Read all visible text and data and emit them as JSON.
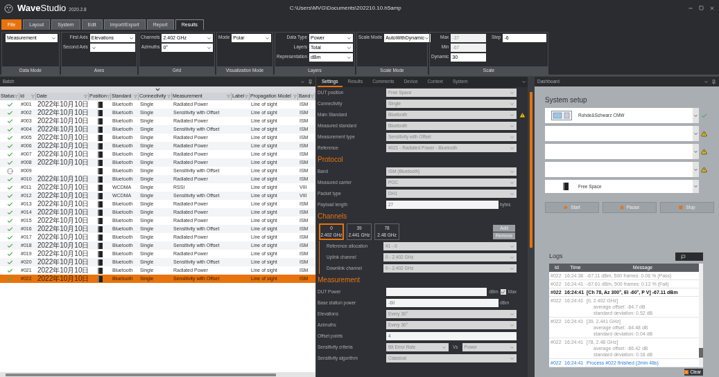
{
  "app": {
    "name_bold": "Wave",
    "name_rest": "Studio",
    "version": "2020.2.8",
    "path": "C:\\Users\\MVG\\Documents\\202210.10.h5amp"
  },
  "menu_tabs": [
    {
      "label": "File",
      "kind": "file",
      "selected": false
    },
    {
      "label": "Layout",
      "kind": "tab",
      "selected": false
    },
    {
      "label": "System",
      "kind": "tab",
      "selected": false
    },
    {
      "label": "Edit",
      "kind": "tab",
      "selected": false
    },
    {
      "label": "Import/Export",
      "kind": "tab",
      "selected": false
    },
    {
      "label": "Report",
      "kind": "tab",
      "selected": false
    },
    {
      "label": "Results",
      "kind": "tab",
      "selected": true
    }
  ],
  "ribbon": [
    {
      "title": "Data Mode",
      "columns": [
        [
          {
            "kind": "select",
            "value": "Measurement",
            "disabled": false
          }
        ]
      ]
    },
    {
      "title": "Axes",
      "columns": [
        [
          {
            "kind": "select",
            "label": "First Axis",
            "value": "Elevations",
            "disabled": false
          },
          {
            "kind": "select",
            "label": "Second Axis",
            "disabled": false
          }
        ]
      ]
    },
    {
      "title": "Grid",
      "columns": [
        [
          {
            "kind": "select",
            "label": "Channels",
            "value": "2.402 GHz",
            "disabled": false
          },
          {
            "kind": "select",
            "label": "Azimuths",
            "value": "0°",
            "disabled": false
          }
        ]
      ]
    },
    {
      "title": "Visualization Mode",
      "columns": [
        [
          {
            "kind": "select",
            "label": "Mode",
            "value": "Polar",
            "disabled": false
          }
        ]
      ]
    },
    {
      "title": "Layers",
      "columns": [
        [
          {
            "kind": "select",
            "label": "Data Type",
            "value": "Power",
            "disabled": false
          },
          {
            "kind": "select",
            "label": "Layers",
            "value": "Total",
            "disabled": false
          },
          {
            "kind": "select",
            "label": "Representation",
            "value": "dBm",
            "disabled": false
          }
        ]
      ]
    },
    {
      "title": "Scale Mode",
      "columns": [
        [
          {
            "kind": "select",
            "label": "Scale Mode",
            "value": "AutoWithDynamic",
            "disabled": false
          }
        ]
      ]
    },
    {
      "title": "Scale",
      "columns": [
        [
          {
            "kind": "input",
            "label": "Max",
            "value": "-37",
            "disabled": true
          },
          {
            "kind": "input",
            "label": "Min",
            "value": "-67",
            "disabled": true
          },
          {
            "kind": "input",
            "label": "Dynamic",
            "value": "30",
            "disabled": false
          }
        ],
        [
          {
            "kind": "input",
            "label": "Step",
            "value": "-6",
            "disabled": false
          }
        ]
      ]
    }
  ],
  "batch": {
    "title": "Batch",
    "columns": [
      "Status",
      "Id",
      "Date",
      "Position",
      "Standard",
      "Connectivity",
      "Measurement",
      "Label",
      "Propagation Model",
      "Band"
    ],
    "rows": [
      {
        "kind": "done",
        "id": "#001",
        "date": "2022年10月10日",
        "standard": "Bluetooth",
        "connectivity": "Single",
        "measurement": "Radiated Power",
        "propagation_model": "Line of sight",
        "band": "ISM",
        "selected": false
      },
      {
        "kind": "done",
        "id": "#002",
        "date": "2022年10月10日",
        "standard": "Bluetooth",
        "connectivity": "Single",
        "measurement": "Sensitivity with Offset",
        "propagation_model": "Line of sight",
        "band": "ISM",
        "selected": false
      },
      {
        "kind": "done",
        "id": "#003",
        "date": "2022年10月10日",
        "standard": "Bluetooth",
        "connectivity": "Single",
        "measurement": "Radiated Power",
        "propagation_model": "Line of sight",
        "band": "ISM",
        "selected": false
      },
      {
        "kind": "done",
        "id": "#004",
        "date": "2022年10月10日",
        "standard": "Bluetooth",
        "connectivity": "Single",
        "measurement": "Sensitivity with Offset",
        "propagation_model": "Line of sight",
        "band": "ISM",
        "selected": false
      },
      {
        "kind": "done",
        "id": "#005",
        "date": "2022年10月10日",
        "standard": "Bluetooth",
        "connectivity": "Single",
        "measurement": "Radiated Power",
        "propagation_model": "Line of sight",
        "band": "ISM",
        "selected": false
      },
      {
        "kind": "done",
        "id": "#006",
        "date": "2022年10月10日",
        "standard": "Bluetooth",
        "connectivity": "Single",
        "measurement": "Radiated Power",
        "propagation_model": "Line of sight",
        "band": "ISM",
        "selected": false
      },
      {
        "kind": "done",
        "id": "#007",
        "date": "2022年10月10日",
        "standard": "Bluetooth",
        "connectivity": "Single",
        "measurement": "Radiated Power",
        "propagation_model": "Line of sight",
        "band": "ISM",
        "selected": false
      },
      {
        "kind": "done",
        "id": "#008",
        "date": "2022年10月10日",
        "standard": "Bluetooth",
        "connectivity": "Single",
        "measurement": "Radiated Power",
        "propagation_model": "Line of sight",
        "band": "ISM",
        "selected": false
      },
      {
        "kind": "pending",
        "id": "#009",
        "standard": "Bluetooth",
        "connectivity": "Single",
        "measurement": "Sensitivity with Offset",
        "propagation_model": "Line of sight",
        "band": "ISM",
        "selected": false
      },
      {
        "kind": "done",
        "id": "#010",
        "date": "2022年10月10日",
        "standard": "Bluetooth",
        "connectivity": "Single",
        "measurement": "Radiated Power",
        "propagation_model": "Line of sight",
        "band": "ISM",
        "selected": false
      },
      {
        "kind": "done",
        "id": "#011",
        "date": "2022年10月10日",
        "standard": "WCDMA",
        "connectivity": "Single",
        "measurement": "RSSI",
        "propagation_model": "Line of sight",
        "band": "VIII",
        "selected": false
      },
      {
        "kind": "done",
        "id": "#012",
        "date": "2022年10月10日",
        "standard": "WCDMA",
        "connectivity": "Single",
        "measurement": "Sensitivity with Offset",
        "propagation_model": "Line of sight",
        "band": "VIII",
        "selected": false
      },
      {
        "kind": "done",
        "id": "#013",
        "date": "2022年10月10日",
        "standard": "Bluetooth",
        "connectivity": "Single",
        "measurement": "Radiated Power",
        "propagation_model": "Line of sight",
        "band": "ISM",
        "selected": false
      },
      {
        "kind": "done",
        "id": "#014",
        "date": "2022年10月10日",
        "standard": "Bluetooth",
        "connectivity": "Single",
        "measurement": "Radiated Power",
        "propagation_model": "Line of sight",
        "band": "ISM",
        "selected": false
      },
      {
        "kind": "done",
        "id": "#015",
        "date": "2022年10月10日",
        "standard": "Bluetooth",
        "connectivity": "Single",
        "measurement": "Radiated Power",
        "propagation_model": "Line of sight",
        "band": "ISM",
        "selected": false
      },
      {
        "kind": "done",
        "id": "#016",
        "date": "2022年10月10日",
        "standard": "Bluetooth",
        "connectivity": "Single",
        "measurement": "Sensitivity with Offset",
        "propagation_model": "Line of sight",
        "band": "ISM",
        "selected": false
      },
      {
        "kind": "done",
        "id": "#017",
        "date": "2022年10月10日",
        "standard": "Bluetooth",
        "connectivity": "Single",
        "measurement": "Radiated Power",
        "propagation_model": "Line of sight",
        "band": "ISM",
        "selected": false
      },
      {
        "kind": "done",
        "id": "#018",
        "date": "2022年10月10日",
        "standard": "Bluetooth",
        "connectivity": "Single",
        "measurement": "Sensitivity with Offset",
        "propagation_model": "Line of sight",
        "band": "ISM",
        "selected": false
      },
      {
        "kind": "done",
        "id": "#019",
        "date": "2022年10月10日",
        "standard": "Bluetooth",
        "connectivity": "Single",
        "measurement": "Radiated Power",
        "propagation_model": "Line of sight",
        "band": "ISM",
        "selected": false
      },
      {
        "kind": "done",
        "id": "#020",
        "date": "2022年10月10日",
        "standard": "Bluetooth",
        "connectivity": "Single",
        "measurement": "Sensitivity with Offset",
        "propagation_model": "Line of sight",
        "band": "ISM",
        "selected": false
      },
      {
        "kind": "done",
        "id": "#021",
        "date": "2022年10月10日",
        "standard": "Bluetooth",
        "connectivity": "Single",
        "measurement": "Radiated Power",
        "propagation_model": "Line of sight",
        "band": "ISM",
        "selected": false
      },
      {
        "kind": "done",
        "id": "#022",
        "date": "2022年10月10日",
        "standard": "Bluetooth",
        "connectivity": "Single",
        "measurement": "Sensitivity with Offset",
        "propagation_model": "Line of sight",
        "band": "ISM",
        "selected": true
      }
    ]
  },
  "settings": {
    "tabs": [
      {
        "label": "Settings",
        "selected": true
      },
      {
        "label": "Results",
        "selected": false
      },
      {
        "label": "Comments",
        "selected": false
      },
      {
        "label": "Device",
        "selected": false
      },
      {
        "label": "Context",
        "selected": false
      },
      {
        "label": "System",
        "selected": false
      }
    ],
    "sections": [
      {
        "rows": [
          {
            "kind": "select",
            "label": "DUT position",
            "value": "Free Space",
            "warning": false
          },
          {
            "kind": "select",
            "label": "Connectivity",
            "value": "Single",
            "warning": false
          },
          {
            "kind": "select",
            "label": "Main Standard",
            "value": "Bluetooth",
            "warning": true
          },
          {
            "kind": "select",
            "label": "Measured standard",
            "value": "Bluetooth",
            "warning": false
          },
          {
            "kind": "select",
            "label": "Measurement type",
            "value": "Sensitivity with Offset",
            "warning": false
          },
          {
            "kind": "select",
            "label": "Reference",
            "value": "#021 - Radiated Power - Bluetooth",
            "warning": false
          }
        ]
      },
      {
        "heading": "Protocol",
        "rows": [
          {
            "kind": "select",
            "label": "Band",
            "value": "ISM (Bluetooth)",
            "warning": false
          },
          {
            "kind": "select",
            "label": "Measured carrier",
            "value": "POC",
            "warning": false
          },
          {
            "kind": "select",
            "label": "Packet type",
            "value": "DH1",
            "warning": false
          },
          {
            "kind": "text",
            "label": "Payload length",
            "value": "27",
            "unit": "bytes",
            "warning": false
          }
        ]
      },
      {
        "heading": "Channels",
        "channels": [
          {
            "number": "0",
            "frequency": "2.402 GHz",
            "selected": true
          },
          {
            "number": "39",
            "frequency": "2.441 GHz",
            "selected": false
          },
          {
            "number": "78",
            "frequency": "2.48 GHz",
            "selected": false
          }
        ],
        "channel_buttons": [
          "Add",
          "Remove"
        ],
        "rows": [
          {
            "kind": "select",
            "label": "Reference allocation",
            "value": "#1 - 0",
            "warning": false
          },
          {
            "kind": "select",
            "label": "Uplink channel",
            "value": "0 - 2.402 GHz",
            "warning": false
          },
          {
            "kind": "select",
            "label": "Downlink channel",
            "value": "0 - 2.402 GHz",
            "warning": false
          }
        ]
      },
      {
        "heading": "Measurement",
        "rows": [
          {
            "kind": "text-check",
            "label": "DUT Power",
            "unit": "dBm",
            "check_label": "Max",
            "checked": true,
            "warning": false
          },
          {
            "kind": "text",
            "label": "Base station power",
            "value": "-60",
            "unit": "dBm",
            "warning": false
          },
          {
            "kind": "select",
            "label": "Elevations",
            "value": "Every 30°",
            "warning": false
          },
          {
            "kind": "select",
            "label": "Azimuths",
            "value": "Every 30°",
            "warning": false
          },
          {
            "kind": "text",
            "label": "Offset points",
            "value": "4",
            "warning": false
          },
          {
            "kind": "select-pair",
            "label": "Sensitivity criteria",
            "value": "Bit Error Rate",
            "joiner": "Vs",
            "value2": "Power",
            "warning": false
          },
          {
            "kind": "select",
            "label": "Sensitivity algorithm",
            "value": "Classical",
            "warning": false
          }
        ]
      }
    ]
  },
  "dashboard": {
    "title": "Dashboard",
    "heading": "System setup",
    "devices": [
      {
        "kind": "instrument",
        "value": "Rohde&Schwarz CMW",
        "ok": true,
        "warning": false
      },
      {
        "kind": "empty",
        "ok": false,
        "warning": true
      },
      {
        "kind": "empty",
        "ok": false,
        "warning": true
      },
      {
        "kind": "empty",
        "ok": false,
        "warning": true
      },
      {
        "kind": "phone",
        "value": "Free Space",
        "ok": false,
        "warning": false
      }
    ],
    "buttons": [
      {
        "label": "Start",
        "kind": "play"
      },
      {
        "label": "Pause",
        "kind": "pause"
      },
      {
        "label": "Stop",
        "kind": "stop"
      }
    ],
    "logs": {
      "title": "Logs",
      "columns": [
        "Id",
        "Time",
        "Message"
      ],
      "rows": [
        {
          "kind": "info",
          "id": "#022",
          "time": "16:24:38",
          "lines": [
            "-67.11 dBm, 500 frames: 0.06 % (Pass)"
          ]
        },
        {
          "kind": "info",
          "id": "#022",
          "time": "16:24:41",
          "lines": [
            "-67.61 dBm, 500 frames: 0.12 % (Fail)"
          ]
        },
        {
          "kind": "result",
          "id": "#022",
          "time": "16:24:41",
          "lines": [
            "[Ch 78, Az 300°, El -60°, P V] -67.11 dBm"
          ]
        },
        {
          "kind": "info",
          "id": "#022",
          "time": "16:24:41",
          "lines": [
            "[0, 2.402 GHz]",
            "average offset: -64.7 dB",
            "standard deviation: 0.52 dB"
          ]
        },
        {
          "kind": "info",
          "id": "#022",
          "time": "16:24:41",
          "lines": [
            "[39, 2.441 GHz]",
            "average offset: -64.48 dB",
            "standard deviation: 0.04 dB"
          ]
        },
        {
          "kind": "info",
          "id": "#022",
          "time": "16:24:41",
          "lines": [
            "[78, 2.48 GHz]",
            "average offset: -66.42 dB",
            "standard deviation: 0.16 dB"
          ]
        },
        {
          "kind": "done",
          "id": "#022",
          "time": "16:24:41",
          "lines": [
            "Process #022 finished (2min 48s)"
          ]
        }
      ],
      "clear_button": "Clear"
    }
  }
}
